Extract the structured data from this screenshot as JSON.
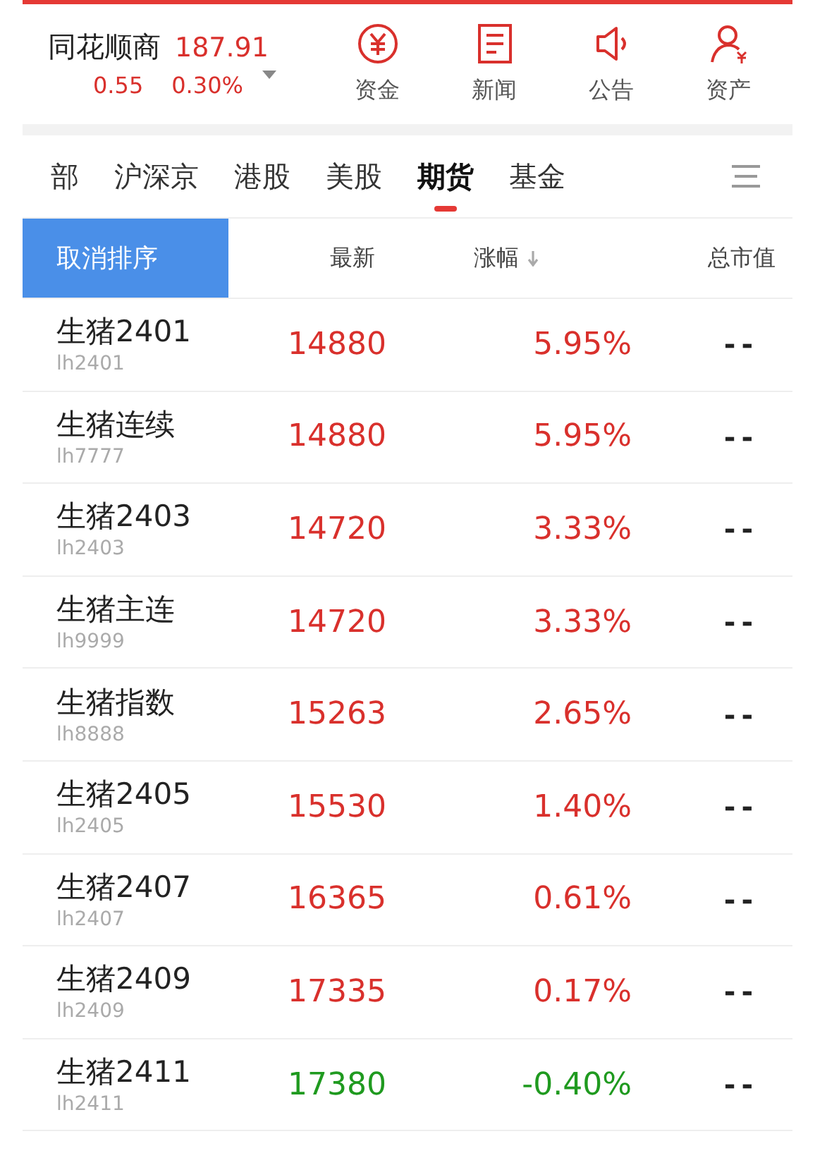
{
  "index": {
    "name": "同花顺商",
    "price": "187.91",
    "change": "0.55",
    "percent": "0.30%"
  },
  "shortcuts": [
    {
      "label": "资金",
      "kind": "yuan"
    },
    {
      "label": "新闻",
      "kind": "news"
    },
    {
      "label": "公告",
      "kind": "speaker"
    },
    {
      "label": "资产",
      "kind": "person"
    }
  ],
  "tabs": [
    {
      "label": "部",
      "selected": false
    },
    {
      "label": "沪深京",
      "selected": false
    },
    {
      "label": "港股",
      "selected": false
    },
    {
      "label": "美股",
      "selected": false
    },
    {
      "label": "期货",
      "selected": true
    },
    {
      "label": "基金",
      "selected": false
    }
  ],
  "sort_button": "取消排序",
  "columns": [
    {
      "label": "最新",
      "sorted": false
    },
    {
      "label": "涨幅",
      "sorted": true
    },
    {
      "label": "总市值",
      "sorted": false
    }
  ],
  "rows": [
    {
      "name": "生猪2401",
      "code": "lh2401",
      "price": "14880",
      "change": "5.95%",
      "cap": "--",
      "color": "#d9302c"
    },
    {
      "name": "生猪连续",
      "code": "lh7777",
      "price": "14880",
      "change": "5.95%",
      "cap": "--",
      "color": "#d9302c"
    },
    {
      "name": "生猪2403",
      "code": "lh2403",
      "price": "14720",
      "change": "3.33%",
      "cap": "--",
      "color": "#d9302c"
    },
    {
      "name": "生猪主连",
      "code": "lh9999",
      "price": "14720",
      "change": "3.33%",
      "cap": "--",
      "color": "#d9302c"
    },
    {
      "name": "生猪指数",
      "code": "lh8888",
      "price": "15263",
      "change": "2.65%",
      "cap": "--",
      "color": "#d9302c"
    },
    {
      "name": "生猪2405",
      "code": "lh2405",
      "price": "15530",
      "change": "1.40%",
      "cap": "--",
      "color": "#d9302c"
    },
    {
      "name": "生猪2407",
      "code": "lh2407",
      "price": "16365",
      "change": "0.61%",
      "cap": "--",
      "color": "#d9302c"
    },
    {
      "name": "生猪2409",
      "code": "lh2409",
      "price": "17335",
      "change": "0.17%",
      "cap": "--",
      "color": "#d9302c"
    },
    {
      "name": "生猪2411",
      "code": "lh2411",
      "price": "17380",
      "change": "-0.40%",
      "cap": "--",
      "color": "#1f9a1f"
    }
  ]
}
